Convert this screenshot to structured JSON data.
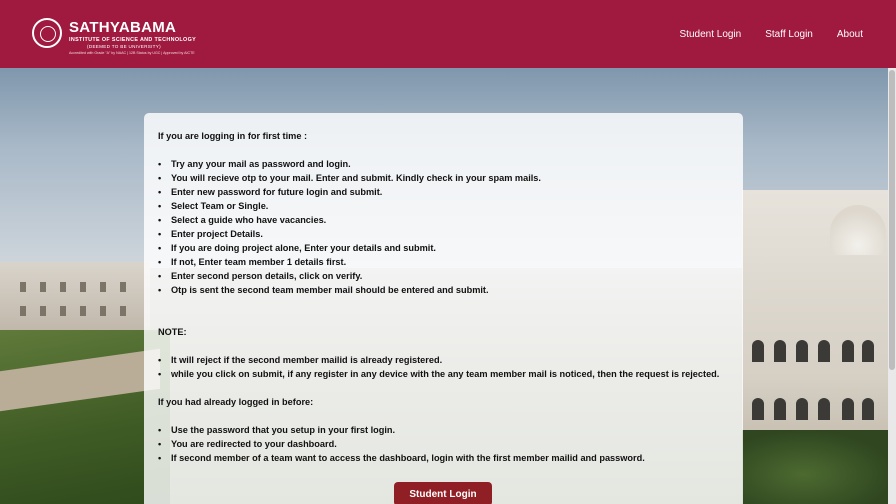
{
  "header": {
    "logo_name": "SATHYABAMA",
    "logo_tagline": "INSTITUTE OF SCIENCE AND TECHNOLOGY",
    "logo_subtagline": "(DEEMED TO BE UNIVERSITY)",
    "logo_accreditation": "Accredited with Grade \"A\" by NAAC  |  12B Status by UGC  |  Approved by AICTE",
    "nav": [
      {
        "label": "Student Login"
      },
      {
        "label": "Staff Login"
      },
      {
        "label": "About"
      }
    ]
  },
  "instructions": {
    "first_time_heading": "If you are logging in for first time :",
    "first_time_steps": [
      "Try any your mail as password and login.",
      "You will recieve otp to your mail. Enter and submit. Kindly check in your spam mails.",
      "Enter new password for future login and submit.",
      "Select Team or Single.",
      "Select a guide who have vacancies.",
      "Enter project Details.",
      "If you are doing project alone, Enter your details and submit.",
      "If not, Enter team member 1 details first.",
      "Enter second person details, click on verify.",
      "Otp is sent the second team member mail should be entered and submit."
    ],
    "note_heading": "NOTE:",
    "note_items": [
      "It will reject if the second member mailid is already registered.",
      "while you click on submit, if any register in any device with the any team member mail is noticed, then the request is rejected."
    ],
    "returning_heading": "If you had already logged in before:",
    "returning_items": [
      "Use the password that you setup in your first login.",
      "You are redirected to your dashboard.",
      "If second member of a team want to access the dashboard, login with the first member mailid and password."
    ],
    "button_label": "Student Login"
  },
  "colors": {
    "header_bg": "#a0193f",
    "button_bg": "#8f1f24"
  }
}
